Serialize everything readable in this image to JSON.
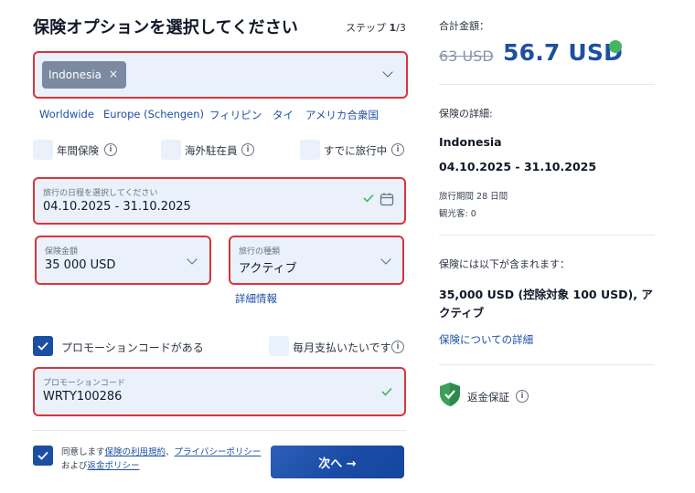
{
  "header": {
    "title": "保険オプションを選択してください",
    "step_label": "ステップ",
    "step_current": "1",
    "step_total": "/3"
  },
  "destination": {
    "chip_label": "Indonesia",
    "chip_remove": "×"
  },
  "quick_destinations": [
    "Worldwide",
    "Europe (Schengen)",
    "フィリピン",
    "タイ",
    "アメリカ合衆国"
  ],
  "options": {
    "annual": "年間保険",
    "expat": "海外駐在員",
    "already_traveling": "すでに旅行中"
  },
  "dates": {
    "label": "旅行の日程を選択してください",
    "value": "04.10.2025 - 31.10.2025"
  },
  "amount": {
    "label": "保険金額",
    "value": "35 000 USD"
  },
  "trip_type": {
    "label": "旅行の種類",
    "value": "アクティブ"
  },
  "details_link": "詳細情報",
  "promo": {
    "checkbox_label": "プロモーションコードがある",
    "field_label": "プロモーションコード",
    "value": "WRTY100286"
  },
  "monthly_label": "毎月支払いたいです",
  "agreement": {
    "prefix": "同意します",
    "terms": "保険の利用規約",
    "comma": "、",
    "privacy": "プライバシーポリシー",
    "and": "および",
    "refund": "返金ポリシー"
  },
  "next_button": "次へ →",
  "summary": {
    "total_label": "合計金額：",
    "old_price": "63 USD",
    "new_price": "56.7 USD",
    "details_label": "保険の詳細:",
    "country": "Indonesia",
    "dates": "04.10.2025 - 31.10.2025",
    "period": "旅行期間 28 日間",
    "travelers": "観光客: 0",
    "includes_label": "保険には以下が含まれます：",
    "includes_text": "35,000 USD (控除対象 100 USD), アクティブ",
    "includes_link": "保険についての詳細",
    "refund_label": "返金保証"
  },
  "colors": {
    "accent": "#1d4fa3",
    "field_bg": "#eaf1fb",
    "highlight": "#d9343b",
    "success": "#44b662"
  }
}
